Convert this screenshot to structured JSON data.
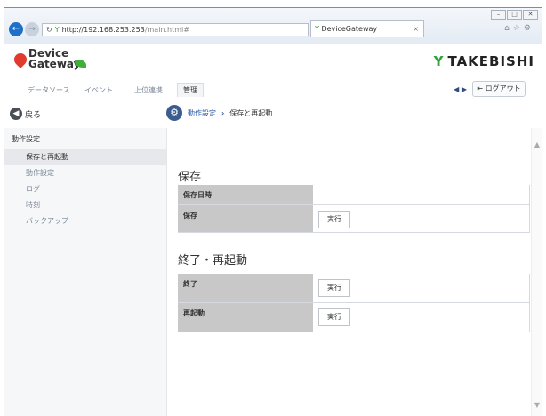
{
  "browser": {
    "address_host": "http://192.168.253.253",
    "address_path": "/main.html#",
    "tab_title": "DeviceGateway"
  },
  "app": {
    "logo_text_line1": "Device",
    "logo_text_line2": "Gateway",
    "brand": "TAKEBISHI"
  },
  "menu": {
    "items": [
      {
        "label": "データソース"
      },
      {
        "label": "イベント"
      },
      {
        "label": "上位連携"
      },
      {
        "label": "管理"
      }
    ],
    "logout_label": "ログアウト"
  },
  "subnav": {
    "back_label": "戻る",
    "breadcrumb_link": "動作設定",
    "breadcrumb_current": "保存と再起動"
  },
  "sidebar": {
    "title": "動作設定",
    "items": [
      {
        "label": "保存と再起動",
        "active": true
      },
      {
        "label": "動作設定"
      },
      {
        "label": "ログ"
      },
      {
        "label": "時刻"
      },
      {
        "label": "バックアップ"
      }
    ]
  },
  "main": {
    "save_section": {
      "title": "保存",
      "rows": [
        {
          "label": "保存日時",
          "value": ""
        },
        {
          "label": "保存",
          "button": "実行"
        }
      ]
    },
    "restart_section": {
      "title": "終了・再起動",
      "rows": [
        {
          "label": "終了",
          "button": "実行"
        },
        {
          "label": "再起動",
          "button": "実行"
        }
      ]
    }
  }
}
